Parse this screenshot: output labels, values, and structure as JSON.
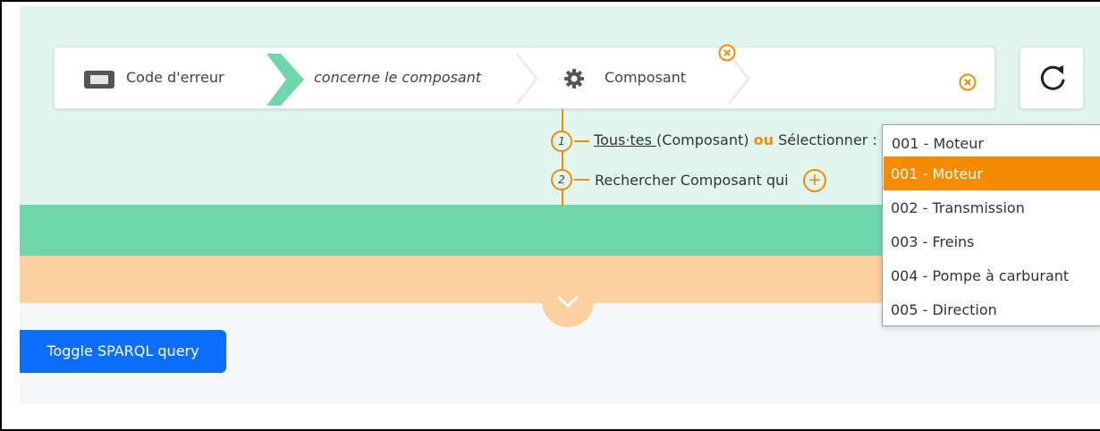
{
  "query_bar": {
    "item1_label": "Code d'erreur",
    "item1_icon": "ticket-icon",
    "property_label": "concerne le composant",
    "item3_label": "Composant",
    "item3_icon": "gear-icon"
  },
  "criteria": {
    "step1_number": "1",
    "step1_link": "Tous·tes ",
    "step1_paren": "(Composant)",
    "step1_or": "ou",
    "step1_select": "Sélectionner :",
    "step2_number": "2",
    "step2_text": "Rechercher Composant qui",
    "add_icon": "+"
  },
  "dropdown": {
    "selected_value": "001 - Moteur",
    "options": [
      {
        "label": "001 - Moteur",
        "highlighted": true
      },
      {
        "label": "002 - Transmission",
        "highlighted": false
      },
      {
        "label": "003 - Freins",
        "highlighted": false
      },
      {
        "label": "004 - Pompe à carburant",
        "highlighted": false
      },
      {
        "label": "005 - Direction",
        "highlighted": false
      }
    ]
  },
  "toggle_button": "Toggle SPARQL query",
  "colors": {
    "query_bg": "#e1f5ef",
    "green_band": "#6fd6ab",
    "orange_band": "#fdd09f",
    "accent_orange": "#f28c00",
    "button_blue": "#0d6efd"
  }
}
